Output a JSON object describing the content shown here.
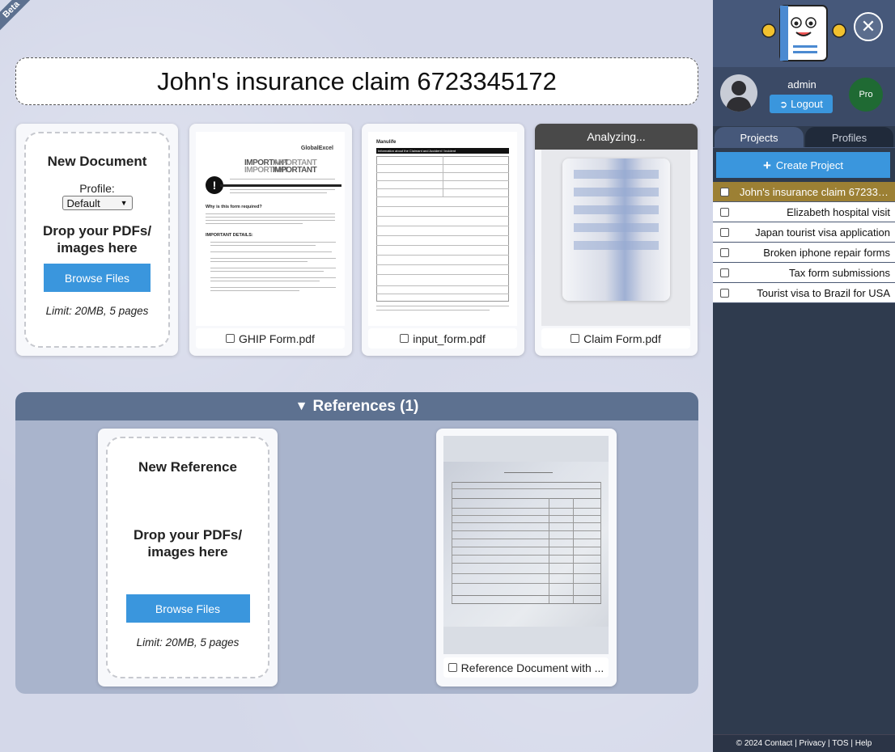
{
  "beta": "Beta",
  "project_title": "John's insurance claim 6723345172",
  "new_document": {
    "title": "New Document",
    "profile_label": "Profile:",
    "profile_value": "Default",
    "drop_text_1": "Drop your PDFs/",
    "drop_text_2": "images here",
    "browse_label": "Browse Files",
    "limit": "Limit: 20MB, 5 pages"
  },
  "documents": [
    {
      "name": "GHIP Form.pdf",
      "status": ""
    },
    {
      "name": "input_form.pdf",
      "status": ""
    },
    {
      "name": "Claim Form.pdf",
      "status": "Analyzing..."
    }
  ],
  "ghip_preview": {
    "brand": "GlobalExcel",
    "heading": "IMPORTANT",
    "section1": "Why is this form required?",
    "section2": "IMPORTANT DETAILS:"
  },
  "input_preview": {
    "brand": "Manulife",
    "banner": "Information about the Claimant and Accident / Incident"
  },
  "references": {
    "header": "References (1)",
    "new_reference": {
      "title": "New Reference",
      "drop_text_1": "Drop your PDFs/",
      "drop_text_2": "images here",
      "browse_label": "Browse Files",
      "limit": "Limit: 20MB, 5 pages"
    },
    "items": [
      {
        "name": "Reference Document with ..."
      }
    ]
  },
  "sidebar": {
    "username": "admin",
    "logout_label": "Logout",
    "badge": "Pro",
    "tabs": [
      {
        "label": "Projects",
        "active": true
      },
      {
        "label": "Profiles",
        "active": false
      }
    ],
    "create_label": "Create Project",
    "projects": [
      {
        "name": "John's insurance claim 6723345...",
        "active": true
      },
      {
        "name": "Elizabeth hospital visit",
        "active": false
      },
      {
        "name": "Japan tourist visa application",
        "active": false
      },
      {
        "name": "Broken iphone repair forms",
        "active": false
      },
      {
        "name": "Tax form submissions",
        "active": false
      },
      {
        "name": "Tourist visa to Brazil for USA",
        "active": false
      }
    ],
    "footer": "© 2024 Contact | Privacy | TOS | Help"
  },
  "colors": {
    "accent": "#3a96dd",
    "header": "#5d7190",
    "active_project": "#9c8034",
    "badge": "#1f6a33"
  }
}
